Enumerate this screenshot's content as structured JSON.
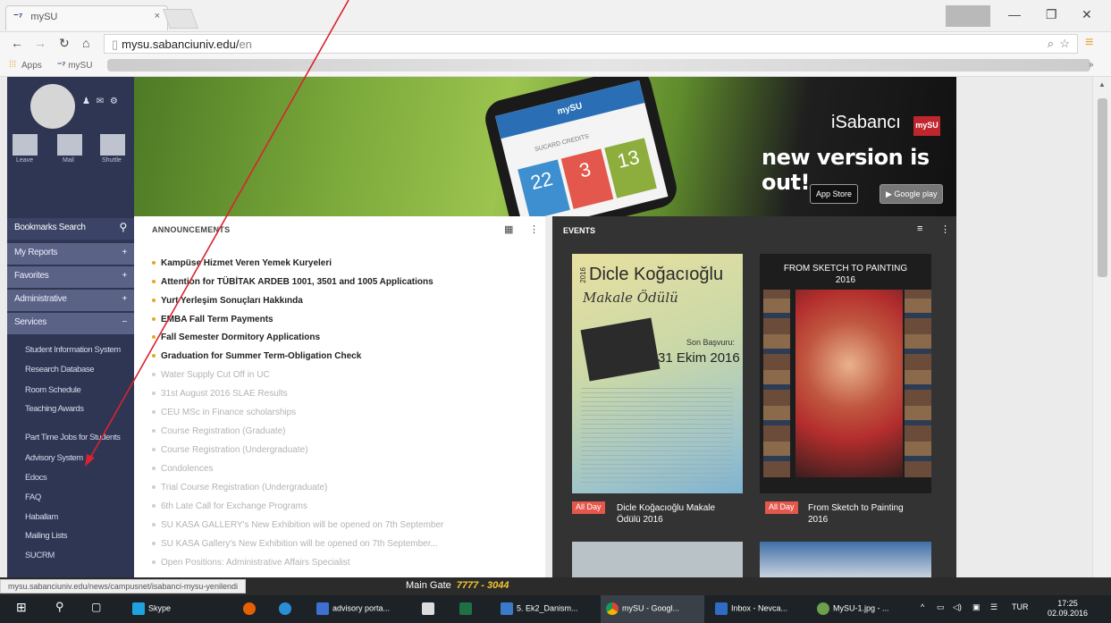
{
  "browser": {
    "tab_title": "mySU",
    "tab_icon": "⁻⁷",
    "tab_close": "×",
    "url_host": "mysu.sabanciuniv.edu/",
    "url_path": "en",
    "bookmark_apps": "Apps",
    "bookmark_mysu": "mySU"
  },
  "sidebar": {
    "quick": [
      "Leave",
      "Mail",
      "Shuttle"
    ],
    "bookmarks_search": "Bookmarks Search",
    "categories": [
      "My Reports",
      "Favorites",
      "Administrative",
      "Services"
    ],
    "category_signs": [
      "+",
      "+",
      "+",
      "−"
    ],
    "services": [
      "Student Information System",
      "Research Database",
      "Room Schedule",
      "Teaching Awards",
      "Part Time Jobs for Students",
      "Advisory System",
      "Edocs",
      "FAQ",
      "Haballam",
      "Mailing Lists",
      "SUCRM"
    ]
  },
  "banner": {
    "app_name": "iSabancı",
    "badge": "mySU",
    "tagline": "new version is out!",
    "app_store": "App Store",
    "google_play": "Google play",
    "phone_header": "mySU",
    "phone_section": "SUCARD CREDITS",
    "tiles": [
      "22",
      "3",
      "13"
    ]
  },
  "announcements": {
    "heading": "ANNOUNCEMENTS",
    "grid_icon": "▦",
    "more_icon": "⋮",
    "bold_items": [
      "Kampüse Hizmet Veren Yemek Kuryeleri",
      "Attention for TÜBİTAK ARDEB 1001, 3501 and 1005 Applications",
      "Yurt Yerleşim Sonuçları Hakkında",
      "EMBA Fall Term Payments",
      "Fall Semester Dormitory Applications",
      "Graduation for Summer Term-Obligation Check"
    ],
    "faded_items": [
      "Water Supply Cut Off in UC",
      "31st August 2016 SLAE Results",
      "CEU MSc in Finance scholarships",
      "Course Registration (Graduate)",
      "Course Registration (Undergraduate)",
      "Condolences",
      "Trial Course Registration (Undergraduate)",
      "6th Late Call for Exchange Programs",
      "SU KASA GALLERY's New Exhibition will be opened on 7th September",
      "SU KASA Gallery's New Exhibition will be opened on 7th September...",
      "Open Positions: Administrative Affairs Specialist"
    ]
  },
  "events": {
    "heading": "EVENTS",
    "list_icon": "≡",
    "more_icon": "⋮",
    "poster1": {
      "year": "2016",
      "title": "Dicle Koğacıoğlu",
      "subtitle": "Makale Ödülü",
      "deadline_label": "Son Başvuru:",
      "deadline": "31 Ekim 2016"
    },
    "poster2": {
      "title": "FROM SKETCH TO PAINTING",
      "year": "2016"
    },
    "items": [
      {
        "tag": "All Day",
        "title_line1": "Dicle Koğacıoğlu Makale",
        "title_line2": "Ödülü 2016"
      },
      {
        "tag": "All Day",
        "title_line1": "From Sketch to Painting",
        "title_line2": "2016"
      }
    ]
  },
  "status": {
    "url": "mysu.sabanciuniv.edu/news/campusnet/isabanci-mysu-yenilendi",
    "gate_label": "Main Gate",
    "gate_number": "7777 - 3044"
  },
  "taskbar": {
    "items": [
      "Skype",
      "advisory porta...",
      "5. Ek2_Danism...",
      "mySU - Googl...",
      "Inbox - Nevca...",
      "MySU-1.jpg - ..."
    ],
    "lang": "TUR",
    "time": "17:25",
    "date": "02.09.2016"
  },
  "colors": {
    "sidebar_bg": "#2e3654",
    "accent_orange": "#e1a81e",
    "allday_red": "#e4574c",
    "annotation_arrow": "#d9232e"
  }
}
